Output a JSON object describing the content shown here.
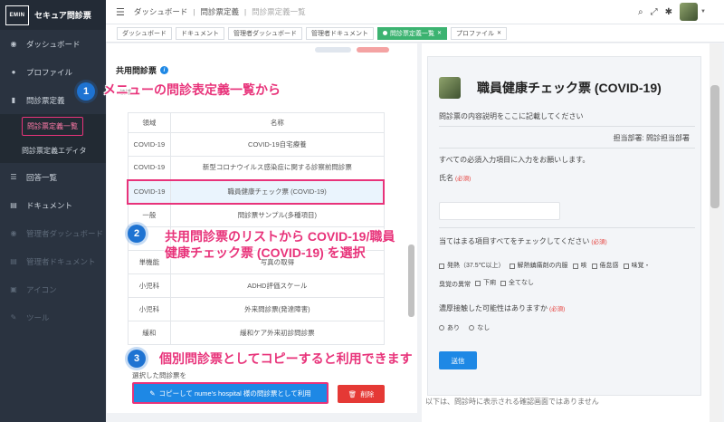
{
  "sidebar": {
    "brand_logo": "EMIN",
    "brand_title": "セキュア問診票",
    "items": [
      {
        "label": "ダッシュボード"
      },
      {
        "label": "プロファイル"
      },
      {
        "label": "問診票定義"
      },
      {
        "label": "回答一覧"
      },
      {
        "label": "ドキュメント"
      },
      {
        "label": "管理者ダッシュボード"
      },
      {
        "label": "管理者ドキュメント"
      },
      {
        "label": "アイコン"
      },
      {
        "label": "ツール"
      }
    ],
    "subitems": [
      {
        "label": "問診票定義一覧"
      },
      {
        "label": "問診票定義エディタ"
      }
    ]
  },
  "header": {
    "breadcrumb": [
      "ダッシュボード",
      "問診票定義",
      "問診票定義一覧"
    ]
  },
  "tabs": [
    {
      "label": "ダッシュボード"
    },
    {
      "label": "ドキュメント"
    },
    {
      "label": "管理者ダッシュボード"
    },
    {
      "label": "管理者ドキュメント"
    },
    {
      "label": "問診票定義一覧"
    },
    {
      "label": "プロファイル"
    }
  ],
  "left": {
    "section_title": "共用問診票",
    "search_label": "領域",
    "columns": [
      "領域",
      "名称"
    ],
    "rows": [
      {
        "area": "COVID-19",
        "name": "COVID-19自宅療養"
      },
      {
        "area": "COVID-19",
        "name": "新型コロナウイルス感染症に関する診察前問診票"
      },
      {
        "area": "COVID-19",
        "name": "職員健康チェック票 (COVID-19)"
      },
      {
        "area": "一般",
        "name": "問診票サンプル(多種項目)"
      },
      {
        "area": "",
        "name": ""
      },
      {
        "area": "単機能",
        "name": "写真の取得"
      },
      {
        "area": "小児科",
        "name": "ADHD評価スケール"
      },
      {
        "area": "小児科",
        "name": "外来問診票(発達障害)"
      },
      {
        "area": "緩和",
        "name": "緩和ケア外来初診問診票"
      }
    ],
    "selected_label": "選択した問診票を",
    "copy_button": "コピーして nume's hospital 様の問診票として利用",
    "delete_button": "削除"
  },
  "right": {
    "form_title": "職員健康チェック票 (COVID-19)",
    "description": "問診票の内容説明をここに記載してください",
    "department": "担当部署: 問診担当部署",
    "instruction": "すべての必須入力項目に入力をお願いします。",
    "name_label": "氏名",
    "required": "(必須)",
    "q1": "当てはまる項目すべてをチェックしてください",
    "q1_options": [
      "発熱（37.5℃以上）",
      "解熱鎮痛剤の内服",
      "咳",
      "倦怠感",
      "味覚・",
      "臭覚の異常",
      "下痢",
      "全てなし"
    ],
    "q2": "濃厚接触した可能性はありますか",
    "q2_options": [
      "あり",
      "なし"
    ],
    "submit": "送信",
    "under_text": "以下は、問診時に表示される確認画面ではありません"
  },
  "annotations": {
    "step1": "1",
    "text1": "メニューの問診表定義一覧から",
    "step2": "2",
    "text2a": "共用問診票のリストから COVID-19/職員",
    "text2b": "健康チェック票 (COVID-19) を選択",
    "step3": "3",
    "text3": "個別問診票としてコピーすると利用できます"
  }
}
